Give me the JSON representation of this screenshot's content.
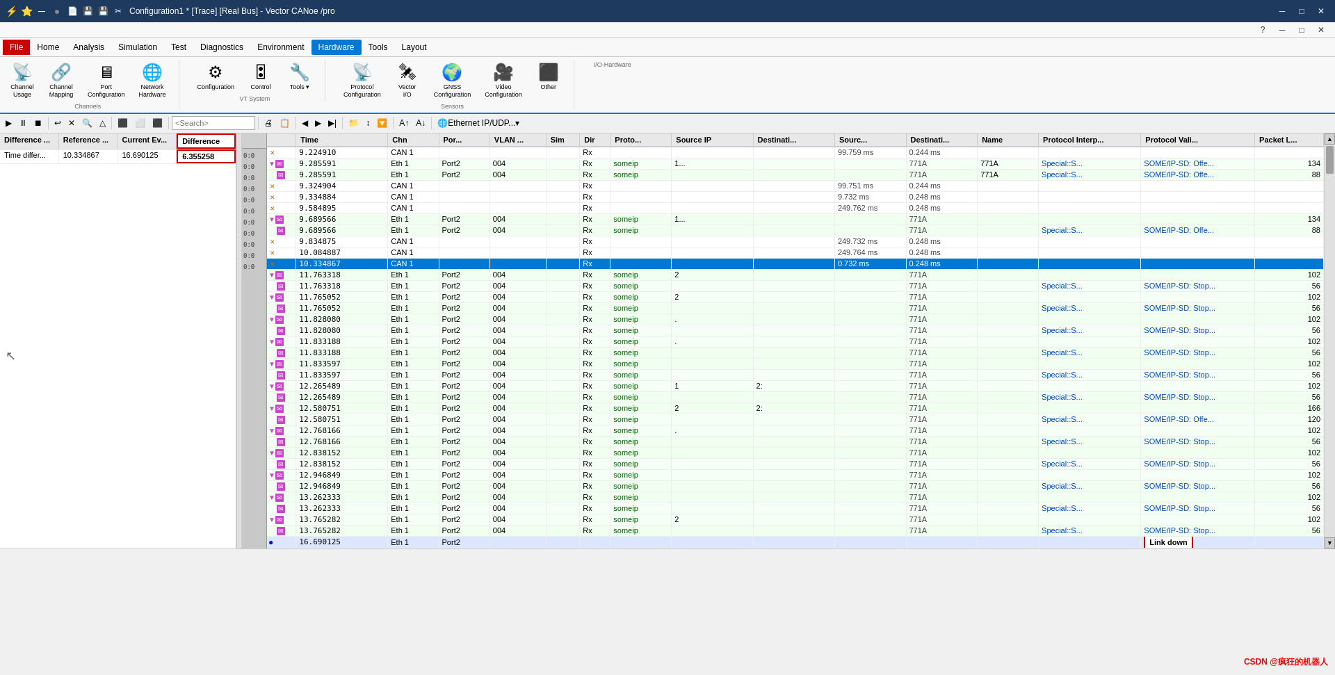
{
  "titleBar": {
    "title": "Configuration1 * [Trace] [Real Bus] - Vector CANoe /pro",
    "minBtn": "─",
    "maxBtn": "□",
    "closeBtn": "✕",
    "icons": [
      "⚡",
      "⭐",
      "─",
      "●",
      "📄",
      "💾",
      "💾",
      "✂"
    ]
  },
  "menuBar": {
    "items": [
      "File",
      "Home",
      "Analysis",
      "Simulation",
      "Test",
      "Diagnostics",
      "Environment",
      "Hardware",
      "Tools",
      "Layout"
    ]
  },
  "ribbon": {
    "groups": [
      {
        "label": "Channels",
        "items": [
          {
            "icon": "📡",
            "label": "Channel\nUsage"
          },
          {
            "icon": "🔗",
            "label": "Channel\nMapping"
          },
          {
            "icon": "🖧",
            "label": "Port\nConfiguration"
          },
          {
            "icon": "🌐",
            "label": "Network\nHardware"
          }
        ]
      },
      {
        "label": "VT System",
        "items": [
          {
            "icon": "⚙",
            "label": "Configuration"
          },
          {
            "icon": "🎛",
            "label": "Control"
          },
          {
            "icon": "🔧",
            "label": "Tools"
          }
        ]
      },
      {
        "label": "Sensors",
        "items": [
          {
            "icon": "📡",
            "label": "Protocol\nConfiguration"
          },
          {
            "icon": "🛰",
            "label": "Vector\nI/O"
          },
          {
            "icon": "🌍",
            "label": "GNSS\nConfiguration"
          },
          {
            "icon": "🎥",
            "label": "Video\nConfiguration"
          },
          {
            "icon": "⋯",
            "label": "Other"
          }
        ]
      },
      {
        "label": "I/O-Hardware",
        "items": []
      }
    ]
  },
  "toolbar": {
    "searchPlaceholder": "<Search>",
    "filterLabel": "Ethernet IP/UDP..."
  },
  "leftPanel": {
    "headers": [
      "Difference ...",
      "Reference ...",
      "Current Ev...",
      "Difference"
    ],
    "row1": [
      "Time differ...",
      "10.334867",
      "16.690125",
      "6.355258"
    ]
  },
  "trace": {
    "columns": [
      "",
      "Time",
      "Chn",
      "Por...",
      "VLAN ...",
      "Sim",
      "Dir",
      "Proto...",
      "Source IP",
      "Destinati...",
      "Sourc...",
      "Destinati...",
      "Name",
      "Protocol Interp...",
      "Protocol Vali...",
      "Packet L..."
    ],
    "rows": [
      {
        "type": "can",
        "time": "9.224910",
        "chn": "CAN 1",
        "port": "",
        "vlan": "",
        "sim": "",
        "dir": "Rx",
        "proto": "",
        "srcip": "",
        "dstip": "",
        "src": "99.759 ms",
        "dst": "0.244 ms",
        "name": "",
        "interp": "",
        "vali": "",
        "pktlen": ""
      },
      {
        "type": "eth",
        "time": "9.285591",
        "chn": "Eth 1",
        "port": "Port2",
        "vlan": "004",
        "sim": "",
        "dir": "Rx",
        "proto": "someip",
        "srcip": "1...",
        "dstip": "",
        "src": "",
        "dst": "771A",
        "name": "771A",
        "interp": "Special::S...",
        "vali": "SOME/IP-SD: Offe...",
        "pktlen": "134"
      },
      {
        "type": "eth-child",
        "time": "9.285591",
        "chn": "Eth 1",
        "port": "Port2",
        "vlan": "004",
        "sim": "",
        "dir": "Rx",
        "proto": "someip",
        "srcip": "",
        "dstip": "",
        "src": "",
        "dst": "771A",
        "name": "771A",
        "interp": "Special::S...",
        "vali": "SOME/IP-SD: Offe...",
        "pktlen": "88"
      },
      {
        "type": "can",
        "time": "9.324904",
        "chn": "CAN 1",
        "port": "",
        "vlan": "",
        "sim": "",
        "dir": "Rx",
        "proto": "",
        "srcip": "",
        "dstip": "",
        "src": "99.751 ms",
        "dst": "0.244 ms",
        "name": "",
        "interp": "",
        "vali": "",
        "pktlen": ""
      },
      {
        "type": "can",
        "time": "9.334884",
        "chn": "CAN 1",
        "port": "",
        "vlan": "",
        "sim": "",
        "dir": "Rx",
        "proto": "",
        "srcip": "",
        "dstip": "",
        "src": "9.732 ms",
        "dst": "0.248 ms",
        "name": "",
        "interp": "",
        "vali": "",
        "pktlen": ""
      },
      {
        "type": "can",
        "time": "9.584895",
        "chn": "CAN 1",
        "port": "",
        "vlan": "",
        "sim": "",
        "dir": "Rx",
        "proto": "",
        "srcip": "",
        "dstip": "",
        "src": "249.762 ms",
        "dst": "0.248 ms",
        "name": "",
        "interp": "",
        "vali": "",
        "pktlen": ""
      },
      {
        "type": "eth",
        "time": "9.689566",
        "chn": "Eth 1",
        "port": "Port2",
        "vlan": "004",
        "sim": "",
        "dir": "Rx",
        "proto": "someip",
        "srcip": "1...",
        "dstip": "",
        "src": "",
        "dst": "771A",
        "name": "",
        "interp": "",
        "vali": "",
        "pktlen": "134"
      },
      {
        "type": "eth-child",
        "time": "9.689566",
        "chn": "Eth 1",
        "port": "Port2",
        "vlan": "004",
        "sim": "",
        "dir": "Rx",
        "proto": "someip",
        "srcip": "",
        "dstip": "",
        "src": "",
        "dst": "771A",
        "name": "",
        "interp": "Special::S...",
        "vali": "SOME/IP-SD: Offe...",
        "pktlen": "88"
      },
      {
        "type": "can",
        "time": "9.834875",
        "chn": "CAN 1",
        "port": "",
        "vlan": "",
        "sim": "",
        "dir": "Rx",
        "proto": "",
        "srcip": "",
        "dstip": "",
        "src": "249.732 ms",
        "dst": "0.248 ms",
        "name": "",
        "interp": "",
        "vali": "",
        "pktlen": ""
      },
      {
        "type": "can",
        "time": "10.084887",
        "chn": "CAN 1",
        "port": "",
        "vlan": "",
        "sim": "",
        "dir": "Rx",
        "proto": "",
        "srcip": "",
        "dstip": "",
        "src": "249.764 ms",
        "dst": "0.248 ms",
        "name": "",
        "interp": "",
        "vali": "",
        "pktlen": ""
      },
      {
        "type": "can-selected",
        "time": "10.334867",
        "chn": "CAN 1",
        "port": "",
        "vlan": "",
        "sim": "",
        "dir": "Rx",
        "proto": "",
        "srcip": "",
        "dstip": "",
        "src": "0.732 ms",
        "dst": "0.248 ms",
        "name": "",
        "interp": "",
        "vali": "",
        "pktlen": ""
      },
      {
        "type": "eth",
        "time": "11.763318",
        "chn": "Eth 1",
        "port": "Port2",
        "vlan": "004",
        "sim": "",
        "dir": "Rx",
        "proto": "someip",
        "srcip": "2",
        "dstip": "",
        "src": "",
        "dst": "771A",
        "name": "",
        "interp": "",
        "vali": "",
        "pktlen": "102"
      },
      {
        "type": "eth-child",
        "time": "11.763318",
        "chn": "Eth 1",
        "port": "Port2",
        "vlan": "004",
        "sim": "",
        "dir": "Rx",
        "proto": "someip",
        "srcip": "",
        "dstip": "",
        "src": "",
        "dst": "771A",
        "name": "",
        "interp": "Special::S...",
        "vali": "SOME/IP-SD: Stop...",
        "pktlen": "56"
      },
      {
        "type": "eth",
        "time": "11.765052",
        "chn": "Eth 1",
        "port": "Port2",
        "vlan": "004",
        "sim": "",
        "dir": "Rx",
        "proto": "someip",
        "srcip": "2",
        "dstip": "",
        "src": "",
        "dst": "771A",
        "name": "",
        "interp": "",
        "vali": "",
        "pktlen": "102"
      },
      {
        "type": "eth-child",
        "time": "11.765052",
        "chn": "Eth 1",
        "port": "Port2",
        "vlan": "004",
        "sim": "",
        "dir": "Rx",
        "proto": "someip",
        "srcip": "",
        "dstip": "",
        "src": "",
        "dst": "771A",
        "name": "",
        "interp": "Special::S...",
        "vali": "SOME/IP-SD: Stop...",
        "pktlen": "56"
      },
      {
        "type": "eth",
        "time": "11.828080",
        "chn": "Eth 1",
        "port": "Port2",
        "vlan": "004",
        "sim": "",
        "dir": "Rx",
        "proto": "someip",
        "srcip": ".",
        "dstip": "",
        "src": "",
        "dst": "771A",
        "name": "",
        "interp": "",
        "vali": "",
        "pktlen": "102"
      },
      {
        "type": "eth-child",
        "time": "11.828080",
        "chn": "Eth 1",
        "port": "Port2",
        "vlan": "004",
        "sim": "",
        "dir": "Rx",
        "proto": "someip",
        "srcip": "",
        "dstip": "",
        "src": "",
        "dst": "771A",
        "name": "",
        "interp": "Special::S...",
        "vali": "SOME/IP-SD: Stop...",
        "pktlen": "56"
      },
      {
        "type": "eth",
        "time": "11.833188",
        "chn": "Eth 1",
        "port": "Port2",
        "vlan": "004",
        "sim": "",
        "dir": "Rx",
        "proto": "someip",
        "srcip": ".",
        "dstip": "",
        "src": "",
        "dst": "771A",
        "name": "",
        "interp": "",
        "vali": "",
        "pktlen": "102"
      },
      {
        "type": "eth-child",
        "time": "11.833188",
        "chn": "Eth 1",
        "port": "Port2",
        "vlan": "004",
        "sim": "",
        "dir": "Rx",
        "proto": "someip",
        "srcip": "",
        "dstip": "",
        "src": "",
        "dst": "771A",
        "name": "",
        "interp": "Special::S...",
        "vali": "SOME/IP-SD: Stop...",
        "pktlen": "56"
      },
      {
        "type": "eth",
        "time": "11.833597",
        "chn": "Eth 1",
        "port": "Port2",
        "vlan": "004",
        "sim": "",
        "dir": "Rx",
        "proto": "someip",
        "srcip": "",
        "dstip": "",
        "src": "",
        "dst": "771A",
        "name": "",
        "interp": "",
        "vali": "",
        "pktlen": "102"
      },
      {
        "type": "eth-child",
        "time": "11.833597",
        "chn": "Eth 1",
        "port": "Port2",
        "vlan": "004",
        "sim": "",
        "dir": "Rx",
        "proto": "someip",
        "srcip": "",
        "dstip": "",
        "src": "",
        "dst": "771A",
        "name": "",
        "interp": "Special::S...",
        "vali": "SOME/IP-SD: Stop...",
        "pktlen": "56"
      },
      {
        "type": "eth",
        "time": "12.265489",
        "chn": "Eth 1",
        "port": "Port2",
        "vlan": "004",
        "sim": "",
        "dir": "Rx",
        "proto": "someip",
        "srcip": "1",
        "dstip": "2:",
        "src": "",
        "dst": "771A",
        "name": "",
        "interp": "",
        "vali": "",
        "pktlen": "102"
      },
      {
        "type": "eth-child",
        "time": "12.265489",
        "chn": "Eth 1",
        "port": "Port2",
        "vlan": "004",
        "sim": "",
        "dir": "Rx",
        "proto": "someip",
        "srcip": "",
        "dstip": "",
        "src": "",
        "dst": "771A",
        "name": "",
        "interp": "Special::S...",
        "vali": "SOME/IP-SD: Stop...",
        "pktlen": "56"
      },
      {
        "type": "eth",
        "time": "12.580751",
        "chn": "Eth 1",
        "port": "Port2",
        "vlan": "004",
        "sim": "",
        "dir": "Rx",
        "proto": "someip",
        "srcip": "2",
        "dstip": "2:",
        "src": "",
        "dst": "771A",
        "name": "",
        "interp": "",
        "vali": "",
        "pktlen": "166"
      },
      {
        "type": "eth-child",
        "time": "12.580751",
        "chn": "Eth 1",
        "port": "Port2",
        "vlan": "004",
        "sim": "",
        "dir": "Rx",
        "proto": "someip",
        "srcip": "",
        "dstip": "",
        "src": "",
        "dst": "771A",
        "name": "",
        "interp": "Special::S...",
        "vali": "SOME/IP-SD: Offe...",
        "pktlen": "120"
      },
      {
        "type": "eth",
        "time": "12.768166",
        "chn": "Eth 1",
        "port": "Port2",
        "vlan": "004",
        "sim": "",
        "dir": "Rx",
        "proto": "someip",
        "srcip": ".",
        "dstip": "",
        "src": "",
        "dst": "771A",
        "name": "",
        "interp": "",
        "vali": "",
        "pktlen": "102"
      },
      {
        "type": "eth-child",
        "time": "12.768166",
        "chn": "Eth 1",
        "port": "Port2",
        "vlan": "004",
        "sim": "",
        "dir": "Rx",
        "proto": "someip",
        "srcip": "",
        "dstip": "",
        "src": "",
        "dst": "771A",
        "name": "",
        "interp": "Special::S...",
        "vali": "SOME/IP-SD: Stop...",
        "pktlen": "56"
      },
      {
        "type": "eth",
        "time": "12.838152",
        "chn": "Eth 1",
        "port": "Port2",
        "vlan": "004",
        "sim": "",
        "dir": "Rx",
        "proto": "someip",
        "srcip": "",
        "dstip": "",
        "src": "",
        "dst": "771A",
        "name": "",
        "interp": "",
        "vali": "",
        "pktlen": "102"
      },
      {
        "type": "eth-child",
        "time": "12.838152",
        "chn": "Eth 1",
        "port": "Port2",
        "vlan": "004",
        "sim": "",
        "dir": "Rx",
        "proto": "someip",
        "srcip": "",
        "dstip": "",
        "src": "",
        "dst": "771A",
        "name": "",
        "interp": "Special::S...",
        "vali": "SOME/IP-SD: Stop...",
        "pktlen": "56"
      },
      {
        "type": "eth",
        "time": "12.946849",
        "chn": "Eth 1",
        "port": "Port2",
        "vlan": "004",
        "sim": "",
        "dir": "Rx",
        "proto": "someip",
        "srcip": "",
        "dstip": "",
        "src": "",
        "dst": "771A",
        "name": "",
        "interp": "",
        "vali": "",
        "pktlen": "102"
      },
      {
        "type": "eth-child",
        "time": "12.946849",
        "chn": "Eth 1",
        "port": "Port2",
        "vlan": "004",
        "sim": "",
        "dir": "Rx",
        "proto": "someip",
        "srcip": "",
        "dstip": "",
        "src": "",
        "dst": "771A",
        "name": "",
        "interp": "Special::S...",
        "vali": "SOME/IP-SD: Stop...",
        "pktlen": "56"
      },
      {
        "type": "eth",
        "time": "13.262333",
        "chn": "Eth 1",
        "port": "Port2",
        "vlan": "004",
        "sim": "",
        "dir": "Rx",
        "proto": "someip",
        "srcip": "",
        "dstip": "",
        "src": "",
        "dst": "771A",
        "name": "",
        "interp": "",
        "vali": "",
        "pktlen": "102"
      },
      {
        "type": "eth-child",
        "time": "13.262333",
        "chn": "Eth 1",
        "port": "Port2",
        "vlan": "004",
        "sim": "",
        "dir": "Rx",
        "proto": "someip",
        "srcip": "",
        "dstip": "",
        "src": "",
        "dst": "771A",
        "name": "",
        "interp": "Special::S...",
        "vali": "SOME/IP-SD: Stop...",
        "pktlen": "56"
      },
      {
        "type": "eth",
        "time": "13.765282",
        "chn": "Eth 1",
        "port": "Port2",
        "vlan": "004",
        "sim": "",
        "dir": "Rx",
        "proto": "someip",
        "srcip": "2",
        "dstip": "",
        "src": "",
        "dst": "771A",
        "name": "",
        "interp": "",
        "vali": "",
        "pktlen": "102"
      },
      {
        "type": "eth-child",
        "time": "13.765282",
        "chn": "Eth 1",
        "port": "Port2",
        "vlan": "004",
        "sim": "",
        "dir": "Rx",
        "proto": "someip",
        "srcip": "",
        "dstip": "",
        "src": "",
        "dst": "771A",
        "name": "",
        "interp": "Special::S...",
        "vali": "SOME/IP-SD: Stop...",
        "pktlen": "56"
      },
      {
        "type": "eth-last",
        "time": "16.690125",
        "chn": "Eth 1",
        "port": "Port2",
        "vlan": "",
        "sim": "",
        "dir": "",
        "proto": "",
        "srcip": "",
        "dstip": "",
        "src": "",
        "dst": "",
        "name": "",
        "interp": "",
        "vali": "Link down",
        "pktlen": ""
      }
    ]
  },
  "statusBar": {
    "text": ""
  }
}
